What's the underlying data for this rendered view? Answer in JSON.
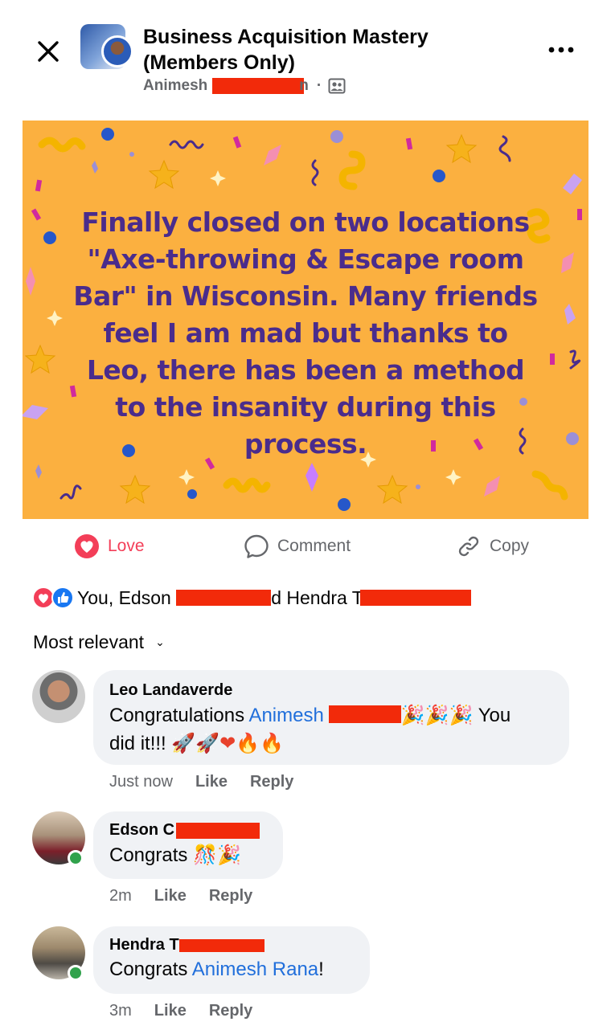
{
  "header": {
    "close_icon": "close-icon",
    "group_name": "Business Acquisition Mastery (Members Only)",
    "author_first": "Animesh",
    "author_suffix": "n",
    "separator": "·",
    "privacy_icon": "group-members-icon",
    "more_icon": "more-horizontal-icon"
  },
  "post": {
    "text": "Finally closed on two locations \"Axe-throwing & Escape room Bar\" in Wisconsin. Many friends feel I am mad but thanks to Leo, there has been a method to the insanity during this process.",
    "background_color": "#fbb040",
    "text_color": "#4a2c8c"
  },
  "actions": {
    "love_label": "Love",
    "comment_label": "Comment",
    "copy_label": "Copy"
  },
  "reactions": {
    "summary_start": "You, Edson ",
    "summary_mid": "d Hendra T"
  },
  "sort": {
    "label": "Most relevant",
    "chevron": "⌄"
  },
  "comments": [
    {
      "name": "Leo Landaverde",
      "text_before": "Congratulations ",
      "mention": "Animesh",
      "text_after": " You",
      "line2": "did it!!! ",
      "emoji_line1": "🎉🎉🎉",
      "emoji_line2": "🚀🚀❤🔥🔥",
      "time": "Just now",
      "like": "Like",
      "reply": "Reply"
    },
    {
      "name": "Edson C",
      "text": "Congrats ",
      "emoji": "🎊🎉",
      "time": "2m",
      "like": "Like",
      "reply": "Reply"
    },
    {
      "name": "Hendra T",
      "text": "Congrats ",
      "mention": "Animesh Rana",
      "text_after": "!",
      "time": "3m",
      "like": "Like",
      "reply": "Reply"
    }
  ],
  "colors": {
    "love": "#f33e58",
    "link": "#216fdb",
    "muted": "#65676b",
    "bubble": "#f0f2f5",
    "redaction": "#f22a0a",
    "online": "#31a24c"
  }
}
